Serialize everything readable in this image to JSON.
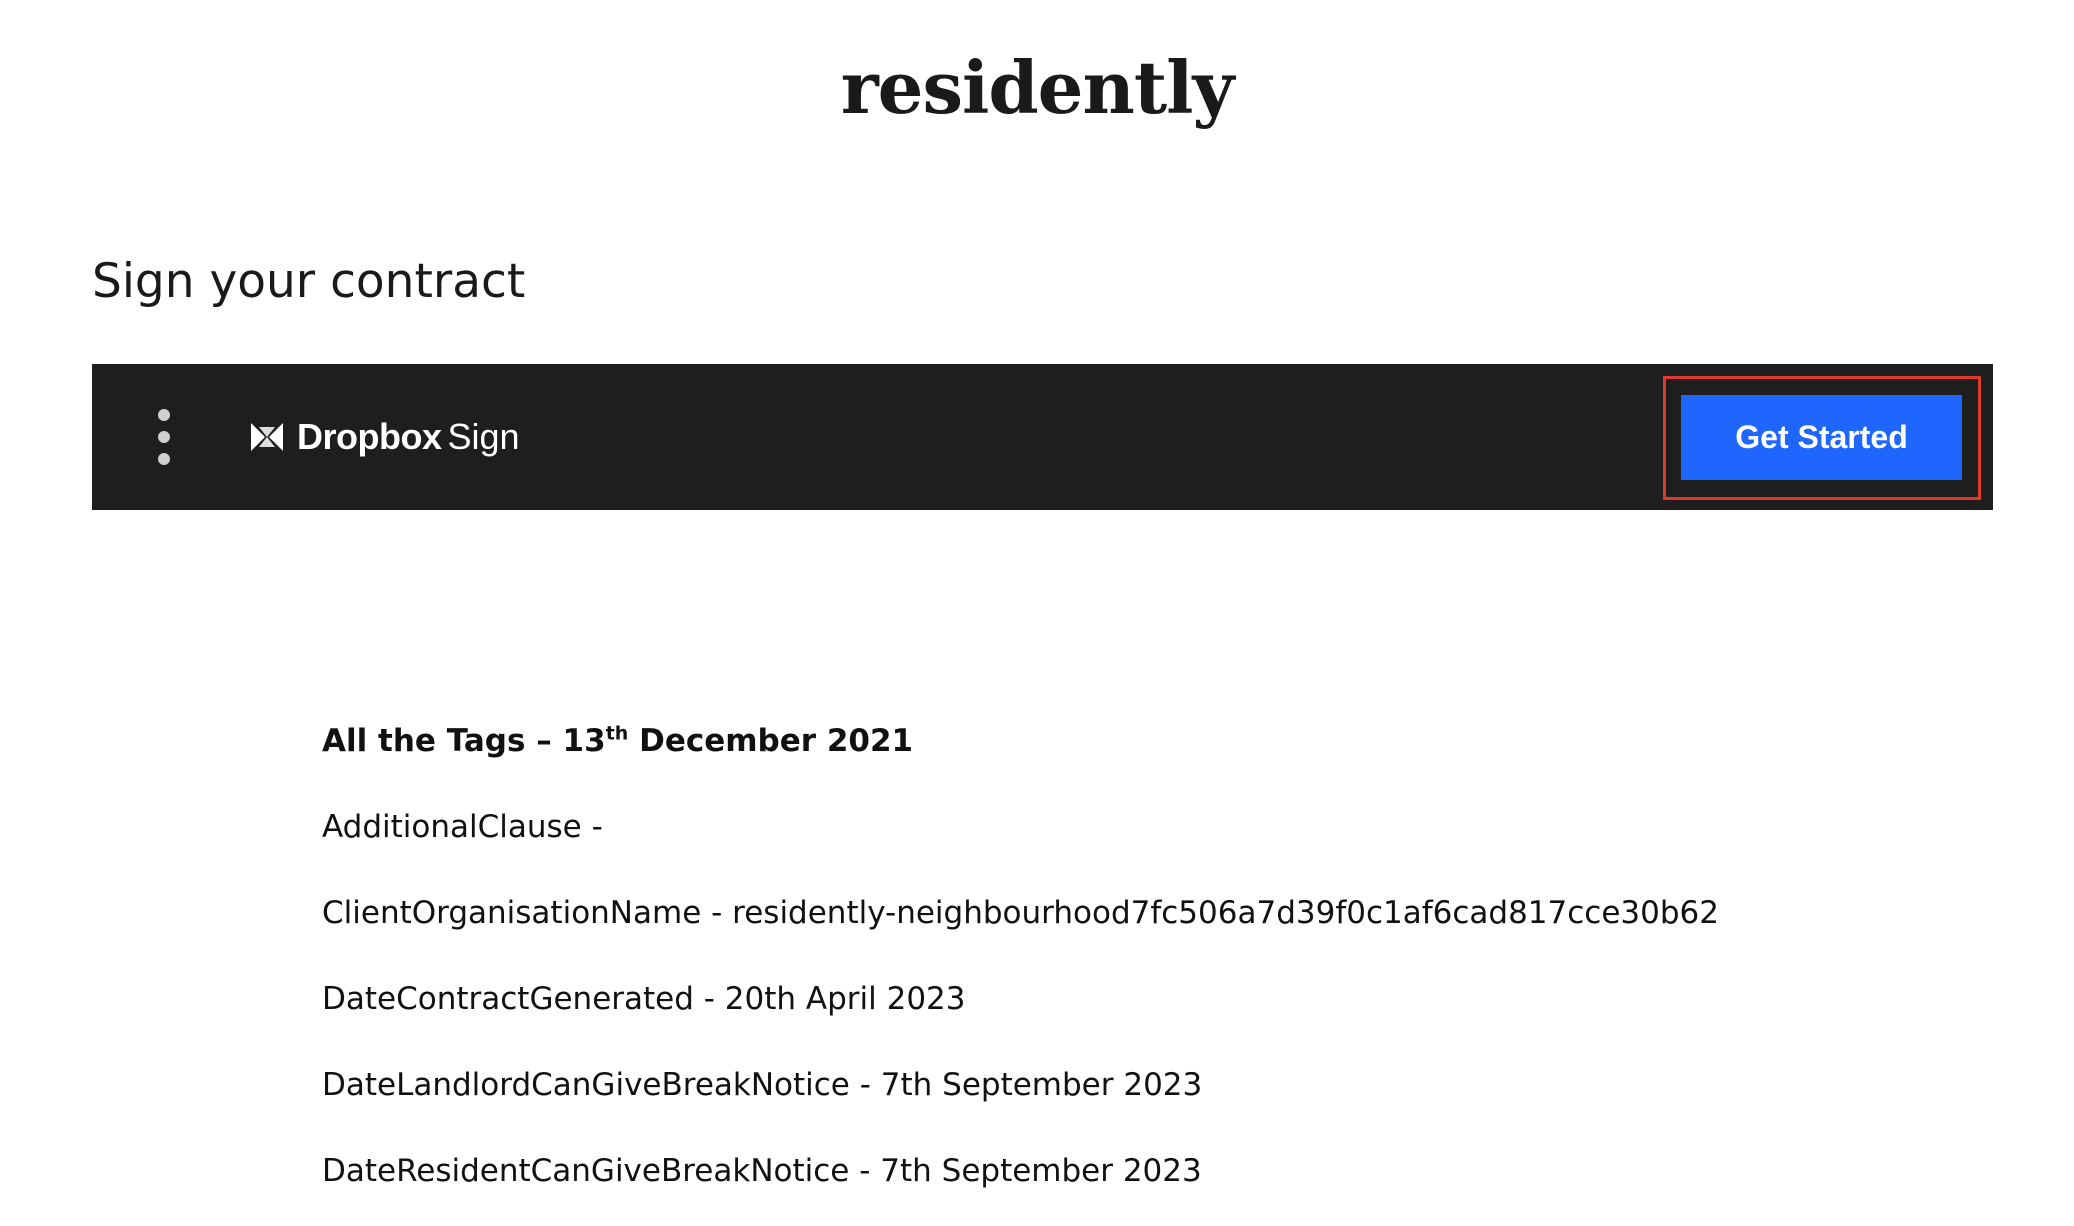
{
  "header": {
    "logo_text": "residently"
  },
  "page": {
    "title": "Sign your contract"
  },
  "sign_bar": {
    "brand_name": "Dropbox",
    "brand_suffix": "Sign",
    "get_started_label": "Get Started",
    "menu_icon": "kebab-menu-icon",
    "brand_icon": "dropbox-logo-icon",
    "colors": {
      "bar_background": "#1e1e1e",
      "button_background": "#1f66ff",
      "highlight_border": "#e0392b"
    }
  },
  "document": {
    "heading_prefix": "All the Tags – 13",
    "heading_sup": "th",
    "heading_suffix": " December 2021",
    "lines": [
      "AdditionalClause -",
      "ClientOrganisationName - residently-neighbourhood7fc506a7d39f0c1af6cad817cce30b62",
      "DateContractGenerated - 20th April 2023",
      "DateLandlordCanGiveBreakNotice - 7th September 2023",
      "DateResidentCanGiveBreakNotice - 7th September 2023"
    ]
  }
}
